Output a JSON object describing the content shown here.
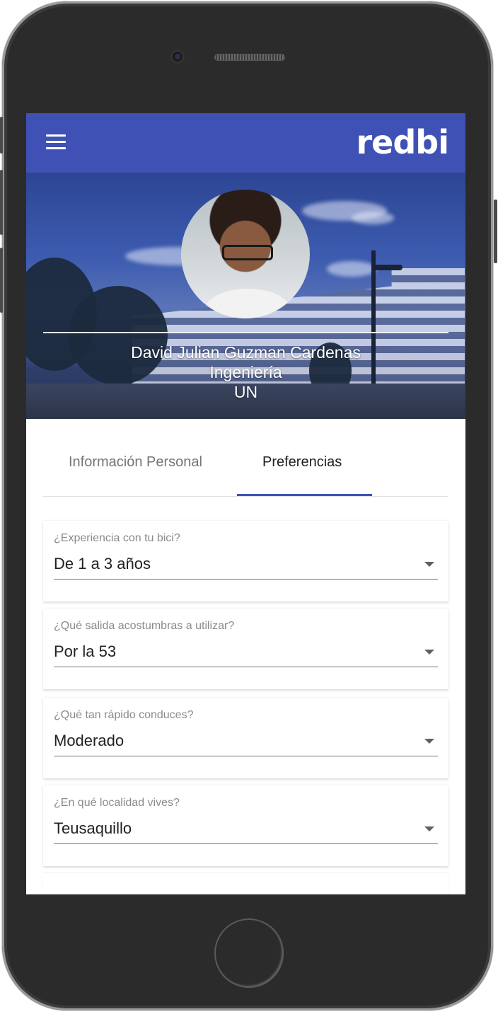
{
  "app": {
    "logo_text": "redbi",
    "brand_color": "#3f51b5"
  },
  "profile": {
    "name": "David Julian Guzman Cardenas",
    "faculty": "Ingeniería",
    "university": "UN"
  },
  "tabs": [
    {
      "label": "Información Personal",
      "selected": false
    },
    {
      "label": "Preferencias",
      "selected": true
    }
  ],
  "fields": [
    {
      "label": "¿Experiencia con tu bici?",
      "value": "De 1 a 3 años"
    },
    {
      "label": "¿Qué salida acostumbras a utilizar?",
      "value": "Por la 53"
    },
    {
      "label": "¿Qué tan rápido conduces?",
      "value": "Moderado"
    },
    {
      "label": "¿En qué localidad vives?",
      "value": "Teusaquillo"
    }
  ],
  "icons": {
    "menu": "hamburger-menu-icon",
    "dropdown": "dropdown-arrow-icon"
  }
}
